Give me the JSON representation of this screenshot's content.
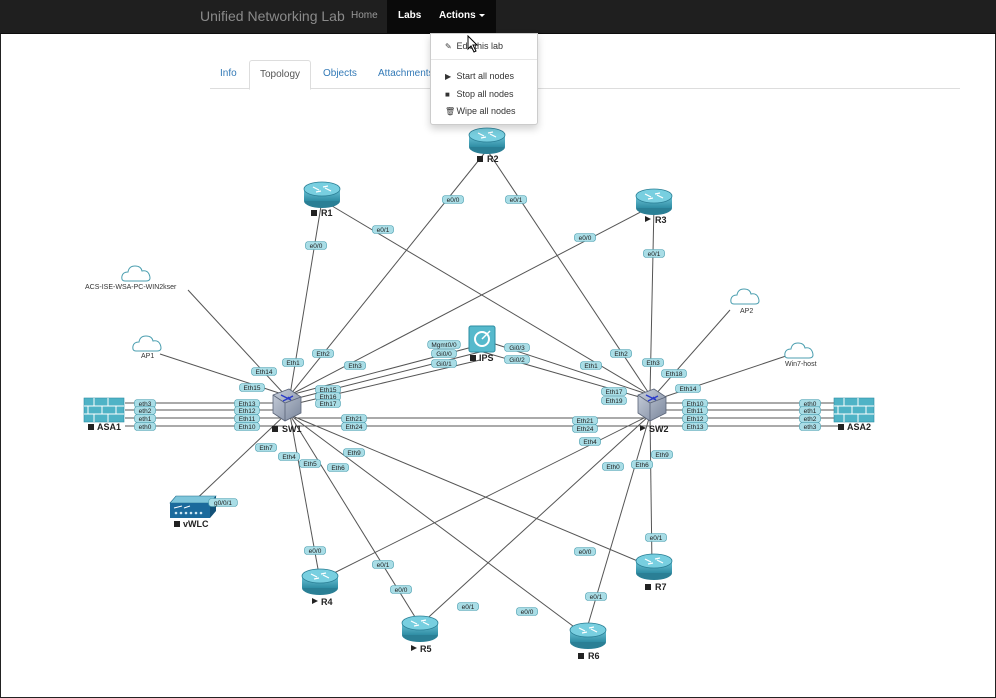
{
  "navbar": {
    "brand": "Unified Networking Lab",
    "items": [
      {
        "label": "Home"
      },
      {
        "label": "Labs"
      },
      {
        "label": "Actions"
      }
    ]
  },
  "tabs": [
    {
      "label": "Info"
    },
    {
      "label": "Topology"
    },
    {
      "label": "Objects"
    },
    {
      "label": "Attachments"
    }
  ],
  "actions_menu": {
    "items": [
      {
        "label": "Edit this lab",
        "icon": "edit-icon"
      },
      {
        "label": "Start all nodes",
        "icon": "play-icon"
      },
      {
        "label": "Stop all nodes",
        "icon": "stop-icon"
      },
      {
        "label": "Wipe all nodes",
        "icon": "trash-icon"
      }
    ]
  },
  "colors": {
    "navbar": "#1f1f1f",
    "link": "#337ab7",
    "router": "#3d9ab0",
    "port_bg": "#a9dde6",
    "port_border": "#4c9fb0",
    "switch": "#6f7f9a",
    "firewall": "#4fb3c6"
  },
  "nodes": {
    "R1": {
      "label": "R1",
      "state": "stopped"
    },
    "R2": {
      "label": "R2",
      "state": "stopped"
    },
    "R3": {
      "label": "R3",
      "state": "running"
    },
    "R4": {
      "label": "R4",
      "state": "running"
    },
    "R5": {
      "label": "R5",
      "state": "running"
    },
    "R6": {
      "label": "R6",
      "state": "stopped"
    },
    "R7": {
      "label": "R7",
      "state": "stopped"
    },
    "SW1": {
      "label": "SW1",
      "state": "stopped"
    },
    "SW2": {
      "label": "SW2",
      "state": "running"
    },
    "ASA1": {
      "label": "ASA1",
      "state": "stopped"
    },
    "ASA2": {
      "label": "ASA2",
      "state": "stopped"
    },
    "IPS": {
      "label": "IPS",
      "state": "stopped"
    },
    "vWLC": {
      "label": "vWLC",
      "state": "stopped"
    },
    "AP1": {
      "label": "AP1"
    },
    "AP2": {
      "label": "AP2"
    },
    "Win7": {
      "label": "Win7-host"
    },
    "ACS": {
      "label": "ACS-ISE-WSA-PC-WIN2kser"
    }
  },
  "ports": {
    "r2_a": "e0/0",
    "r2_b": "e0/1",
    "r1_a": "e0/0",
    "r1_b": "e0/1",
    "r3_a": "e0/0",
    "r3_b": "e0/1",
    "ips_mgmt": "Mgmt0/0",
    "ips_g0": "Gi0/0",
    "ips_g1": "Gi0/1",
    "ips_g3": "Gi0/3",
    "ips_g2": "Gi0/2",
    "sw1_eth14": "Eth14",
    "sw1_eth15": "Eth15",
    "sw1_eth1": "Eth1",
    "sw1_eth2": "Eth2",
    "sw1_eth3": "Eth3",
    "sw1_eth15b": "Eth15",
    "sw1_eth16": "Eth16",
    "sw1_eth17": "Eth17",
    "sw1_eth13": "Eth13",
    "sw1_eth12": "Eth12",
    "sw1_eth11": "Eth11",
    "sw1_eth10": "Eth10",
    "sw1_eth21": "Eth21",
    "sw1_eth24": "Eth24",
    "sw1_eth7": "Eth7",
    "sw1_eth4": "Eth4",
    "sw1_eth5": "Eth5",
    "sw1_eth6": "Eth6",
    "sw1_eth9": "Eth9",
    "asa1_e3": "eth3",
    "asa1_e2": "eth2",
    "asa1_e1": "eth1",
    "asa1_e0": "eth0",
    "sw2_eth1": "Eth1",
    "sw2_eth2": "Eth2",
    "sw2_eth3": "Eth3",
    "sw2_eth18": "Eth18",
    "sw2_eth14": "Eth14",
    "sw2_eth17": "Eth17",
    "sw2_eth19": "Eth19",
    "sw2_eth10": "Eth10",
    "sw2_eth11": "Eth11",
    "sw2_eth12": "Eth12",
    "sw2_eth13": "Eth13",
    "sw2_eth21": "Eth21",
    "sw2_eth24": "Eth24",
    "sw2_eth4": "Eth4",
    "sw2_eth0": "Eth0",
    "sw2_eth6": "Eth6",
    "sw2_eth9": "Eth9",
    "asa2_e0": "eth0",
    "asa2_e1": "eth1",
    "asa2_e2": "eth2",
    "asa2_e3": "eth3",
    "vwlc_g": "g0/0/1",
    "r4_a": "e0/0",
    "r4_b": "e0/1",
    "r5_a": "e0/0",
    "r5_b": "e0/1",
    "r6_a": "e0/0",
    "r6_b": "e0/1",
    "r7_a": "e0/0",
    "r7_b": "e0/1"
  }
}
